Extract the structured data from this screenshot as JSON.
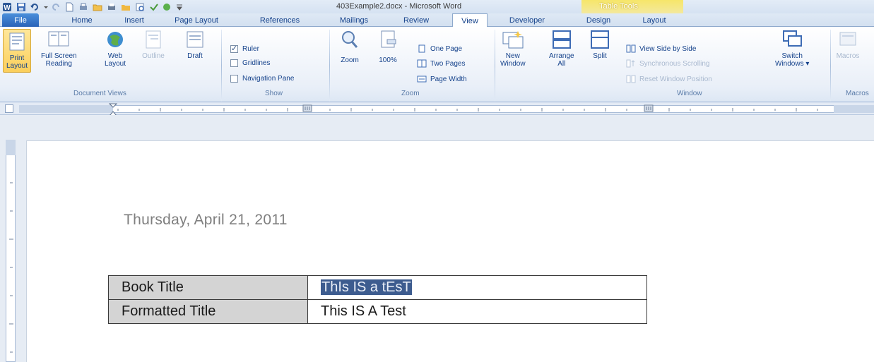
{
  "window": {
    "title": "403Example2.docx - Microsoft Word",
    "context_group": "Table Tools"
  },
  "tabs": [
    "File",
    "Home",
    "Insert",
    "Page Layout",
    "References",
    "Mailings",
    "Review",
    "View",
    "Developer",
    "Design",
    "Layout"
  ],
  "active_tab": "View",
  "ribbon": {
    "document_views": {
      "label": "Document Views",
      "print_layout": [
        "Print",
        "Layout"
      ],
      "full_screen_reading": [
        "Full Screen",
        "Reading"
      ],
      "web_layout": [
        "Web",
        "Layout"
      ],
      "outline": "Outline",
      "draft": "Draft"
    },
    "show": {
      "label": "Show",
      "ruler": "Ruler",
      "gridlines": "Gridlines",
      "navigation_pane": "Navigation Pane",
      "ruler_checked": true,
      "gridlines_checked": false,
      "navigation_checked": false
    },
    "zoom": {
      "label": "Zoom",
      "zoom": "Zoom",
      "hundred": "100%",
      "one_page": "One Page",
      "two_pages": "Two Pages",
      "page_width": "Page Width"
    },
    "window": {
      "label": "Window",
      "new_window": [
        "New",
        "Window"
      ],
      "arrange_all": [
        "Arrange",
        "All"
      ],
      "split": "Split",
      "view_side_by_side": "View Side by Side",
      "synchronous_scrolling": "Synchronous Scrolling",
      "reset_window_position": "Reset Window Position",
      "switch_windows": [
        "Switch",
        "Windows ▾"
      ]
    },
    "macros": {
      "label": "Macros",
      "button": "Macros"
    }
  },
  "document": {
    "date": "Thursday, April 21, 2011",
    "table": [
      {
        "label": "Book Title",
        "value": "ThIs IS a tEsT",
        "selected": true
      },
      {
        "label": "Formatted Title",
        "value": "This IS A Test",
        "selected": false
      }
    ]
  },
  "colors": {
    "selection": "#3d5c8f",
    "context_tab": "#f3e07a",
    "accent": "#2a63b8"
  }
}
